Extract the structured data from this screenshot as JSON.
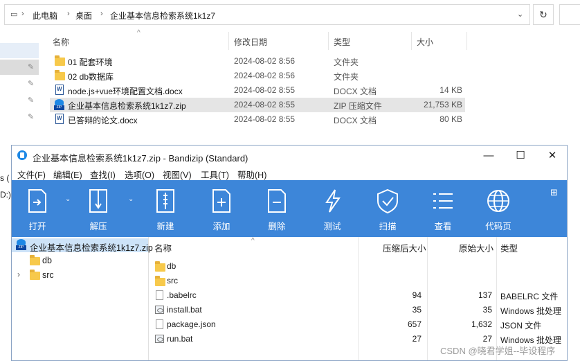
{
  "explorer": {
    "breadcrumb": [
      "此电脑",
      "桌面",
      "企业基本信息检索系统1k1z7"
    ],
    "columns": {
      "name": "名称",
      "date": "修改日期",
      "type": "类型",
      "size": "大小"
    },
    "files": [
      {
        "name": "01  配套环境",
        "date": "2024-08-02 8:56",
        "type": "文件夹",
        "size": "",
        "icon": "folder-icon"
      },
      {
        "name": "02 db数据库",
        "date": "2024-08-02 8:56",
        "type": "文件夹",
        "size": "",
        "icon": "folder-icon"
      },
      {
        "name": "node.js+vue环境配置文档.docx",
        "date": "2024-08-02 8:55",
        "type": "DOCX 文档",
        "size": "14 KB",
        "icon": "docx-icon"
      },
      {
        "name": "企业基本信息检索系统1k1z7.zip",
        "date": "2024-08-02 8:55",
        "type": "ZIP 压缩文件",
        "size": "21,753 KB",
        "icon": "zip-icon"
      },
      {
        "name": "已答辩的论文.docx",
        "date": "2024-08-02 8:55",
        "type": "DOCX 文档",
        "size": "80 KB",
        "icon": "docx-icon"
      }
    ],
    "left_fragments": [
      "s (",
      "D:)"
    ]
  },
  "bandizip": {
    "title": "企业基本信息检索系统1k1z7.zip - Bandizip (Standard)",
    "menu": [
      "文件(F)",
      "编辑(E)",
      "查找(I)",
      "选项(O)",
      "视图(V)",
      "工具(T)",
      "帮助(H)"
    ],
    "toolbar": [
      {
        "label": "打开",
        "icon": "open-icon"
      },
      {
        "label": "解压",
        "icon": "extract-icon"
      },
      {
        "label": "新建",
        "icon": "new-archive-icon"
      },
      {
        "label": "添加",
        "icon": "add-icon"
      },
      {
        "label": "删除",
        "icon": "delete-icon"
      },
      {
        "label": "测试",
        "icon": "test-icon"
      },
      {
        "label": "扫描",
        "icon": "scan-icon"
      },
      {
        "label": "查看",
        "icon": "view-icon"
      },
      {
        "label": "代码页",
        "icon": "codepage-icon"
      }
    ],
    "tree": {
      "root": "企业基本信息检索系统1k1z7.zip",
      "children": [
        "db",
        "src"
      ]
    },
    "list_columns": {
      "name": "名称",
      "compressed": "压缩后大小",
      "original": "原始大小",
      "type": "类型"
    },
    "list": [
      {
        "name": "db",
        "compressed": "",
        "original": "",
        "type": "",
        "icon": "folder-icon"
      },
      {
        "name": "src",
        "compressed": "",
        "original": "",
        "type": "",
        "icon": "folder-icon"
      },
      {
        "name": ".babelrc",
        "compressed": "94",
        "original": "137",
        "type": "BABELRC 文件",
        "icon": "file-icon"
      },
      {
        "name": "install.bat",
        "compressed": "35",
        "original": "35",
        "type": "Windows 批处理",
        "icon": "bat-icon"
      },
      {
        "name": "package.json",
        "compressed": "657",
        "original": "1,632",
        "type": "JSON 文件",
        "icon": "file-icon"
      },
      {
        "name": "run.bat",
        "compressed": "27",
        "original": "27",
        "type": "Windows 批处理",
        "icon": "bat-icon"
      }
    ]
  },
  "watermark": "CSDN @晓君学姐--毕设程序",
  "colors": {
    "toolbar_blue": "#3d86d9",
    "selection": "#cde3f8",
    "folder": "#f7c94b"
  }
}
